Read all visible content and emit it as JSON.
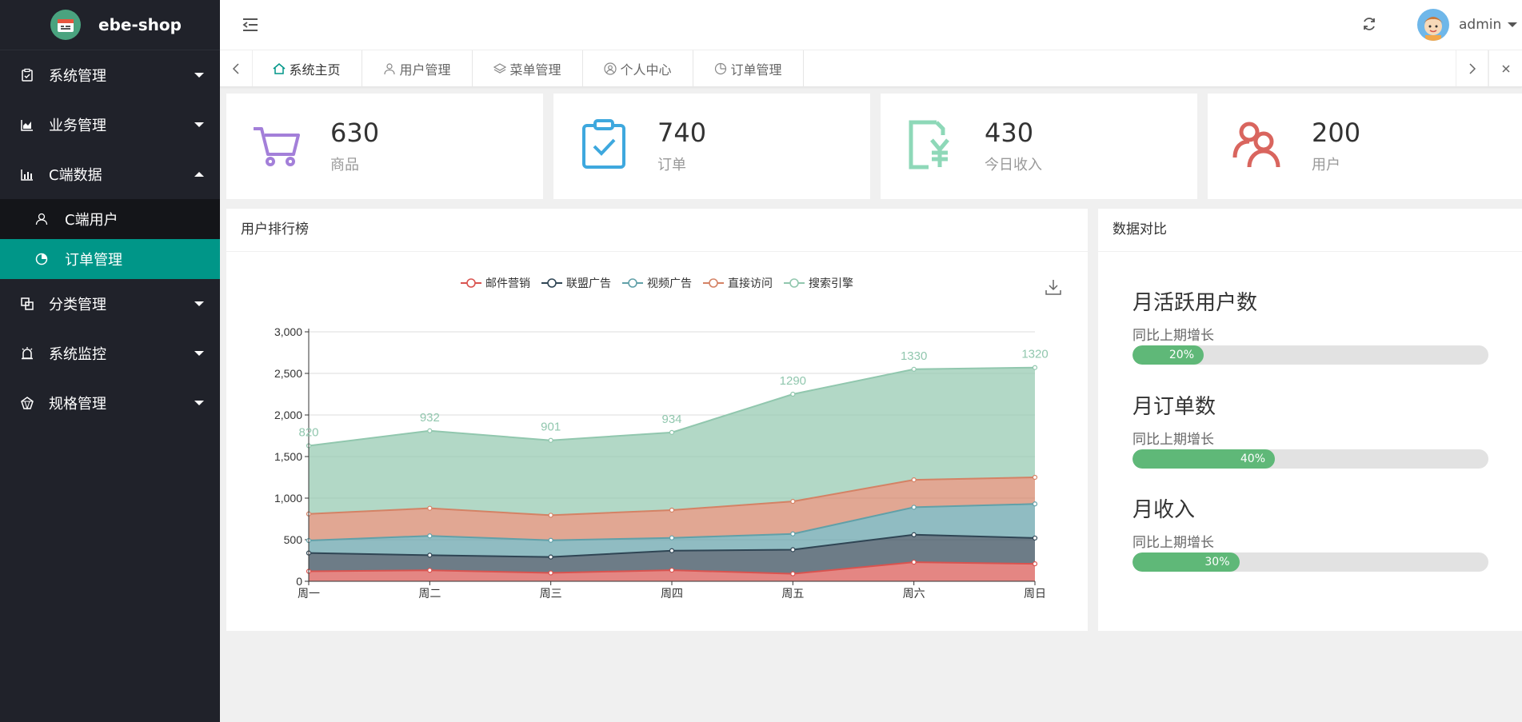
{
  "app": {
    "name": "ebe-shop"
  },
  "sidebar": {
    "items": [
      {
        "label": "系统管理",
        "icon": "clipboard-check-icon"
      },
      {
        "label": "业务管理",
        "icon": "area-chart-icon"
      },
      {
        "label": "C端数据",
        "icon": "bar-chart-icon",
        "expanded": true,
        "children": [
          {
            "label": "C端用户",
            "icon": "user-icon"
          },
          {
            "label": "订单管理",
            "icon": "pie-chart-icon",
            "active": true
          }
        ]
      },
      {
        "label": "分类管理",
        "icon": "copy-icon"
      },
      {
        "label": "系统监控",
        "icon": "alarm-icon"
      },
      {
        "label": "规格管理",
        "icon": "gem-icon"
      }
    ]
  },
  "header": {
    "username": "admin"
  },
  "tabs": [
    {
      "label": "系统主页",
      "icon": "home-icon",
      "active": true
    },
    {
      "label": "用户管理",
      "icon": "user-icon"
    },
    {
      "label": "菜单管理",
      "icon": "layers-icon"
    },
    {
      "label": "个人中心",
      "icon": "user-circle-icon"
    },
    {
      "label": "订单管理",
      "icon": "pie-chart-icon"
    }
  ],
  "stats": [
    {
      "value": "630",
      "label": "商品",
      "color": "#a37fd9"
    },
    {
      "value": "740",
      "label": "订单",
      "color": "#3ea8de"
    },
    {
      "value": "430",
      "label": "今日收入",
      "color": "#8ed8b8"
    },
    {
      "value": "200",
      "label": "用户",
      "color": "#d9655e"
    }
  ],
  "ranking_panel": {
    "title": "用户排行榜"
  },
  "compare_panel": {
    "title": "数据对比",
    "items": [
      {
        "title": "月活跃用户数",
        "sub": "同比上期增长",
        "percent": 20,
        "label": "20%"
      },
      {
        "title": "月订单数",
        "sub": "同比上期增长",
        "percent": 40,
        "label": "40%"
      },
      {
        "title": "月收入",
        "sub": "同比上期增长",
        "percent": 30,
        "label": "30%"
      }
    ]
  },
  "chart_data": {
    "type": "area",
    "stacked": true,
    "categories": [
      "周一",
      "周二",
      "周三",
      "周四",
      "周五",
      "周六",
      "周日"
    ],
    "ylim": [
      0,
      3000
    ],
    "yticks": [
      "0",
      "500",
      "1,000",
      "1,500",
      "2,000",
      "2,500",
      "3,000"
    ],
    "series": [
      {
        "name": "邮件营销",
        "color": "#d9534f",
        "values": [
          120,
          132,
          101,
          134,
          90,
          230,
          210
        ]
      },
      {
        "name": "联盟广告",
        "color": "#2f4554",
        "values": [
          220,
          182,
          191,
          234,
          290,
          330,
          310
        ]
      },
      {
        "name": "视频广告",
        "color": "#61a0a8",
        "values": [
          150,
          232,
          201,
          154,
          190,
          330,
          410
        ]
      },
      {
        "name": "直接访问",
        "color": "#d48265",
        "values": [
          320,
          332,
          301,
          334,
          390,
          330,
          320
        ]
      },
      {
        "name": "搜索引擎",
        "color": "#91c7ae",
        "values": [
          820,
          932,
          901,
          934,
          1290,
          1330,
          1320
        ]
      }
    ],
    "top_labels": [
      "820",
      "932",
      "901",
      "934",
      "1290",
      "1330",
      "1320"
    ],
    "legend_position": "top-center"
  }
}
